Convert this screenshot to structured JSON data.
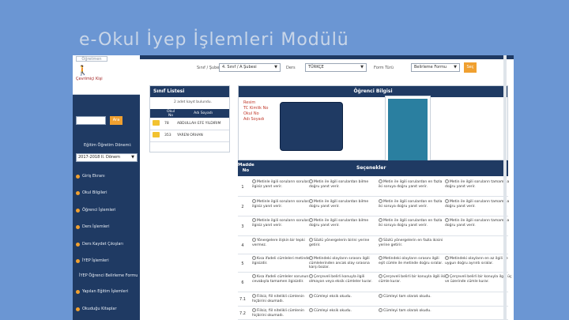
{
  "slide": {
    "title": "e-Okul İyep İşlemleri Modülü"
  },
  "user": {
    "role": "Öğretmen",
    "name": "Çevrimiçi Kişi"
  },
  "sidebar": {
    "search_btn": "Ara",
    "term_label": "Eğitim Öğretim Dönemi:",
    "term_value": "2017-2018 II. Dönem",
    "items": [
      {
        "label": "Giriş Ekranı"
      },
      {
        "label": "Okul Bilgileri"
      },
      {
        "label": "Öğrenci İşlemleri"
      },
      {
        "label": "Ders İşlemleri"
      },
      {
        "label": "Ders Kaydet Çıkışları"
      },
      {
        "label": "İYEP İşlemleri"
      },
      {
        "label": "İYEP Öğrenci Belirleme Formu"
      },
      {
        "label": "Yapılan Eğitim İşlemleri"
      },
      {
        "label": "Okuduğu Kitaplar"
      }
    ]
  },
  "filters": {
    "sinif_label": "Sınıf / Şubesi",
    "sinif_value": "4. Sınıf / A Şubesi",
    "ders_label": "Ders",
    "ders_value": "TÜRKÇE",
    "form_label": "Form Türü",
    "form_value": "Belirleme Formu",
    "go": "Seç"
  },
  "class_list": {
    "title": "Sınıf Listesi",
    "count": "2 adet kayıt bulundu.",
    "col_no": "Okul No",
    "col_name": "Adı Soyadı",
    "rows": [
      {
        "no": "78",
        "name": "ABDULLAH EFE YILDIRIM"
      },
      {
        "no": "353",
        "name": "YAREN ORHAN"
      }
    ]
  },
  "student_info": {
    "title": "Öğrenci Bilgisi",
    "labels": [
      "Resim",
      "TC Kimlik No",
      "Okul No",
      "Adı Soyadı"
    ]
  },
  "options": {
    "col_num": "Madde No",
    "col_title": "Seçenekler",
    "rows": [
      {
        "q": "1",
        "opts": [
          "Metinle ilgili soruların sorulara ilgisiz yanıt verir.",
          "Metin ile ilgili sorulardan bilme doğru yanıt verir.",
          "Metin ile ilgili sorulardan en fazla iki soruya doğru yanıt verir.",
          "Metin ile ilgili soruların tamamına doğru yanıt verir."
        ]
      },
      {
        "q": "2",
        "opts": [
          "Metinle ilgili soruların sorulara ilgisiz yanıt verir.",
          "Metin ile ilgili sorulardan bilme doğru yanıt verir.",
          "Metin ile ilgili sorulardan en fazla iki soruya doğru yanıt verir.",
          "Metin ile ilgili soruların tamamına doğru yanıt verir."
        ]
      },
      {
        "q": "3",
        "opts": [
          "Metinle ilgili soruların sorulara ilgisiz yanıt verir.",
          "Metin ile ilgili sorulardan bilme doğru yanıt verir.",
          "Metin ile ilgili sorulardan en fazla iki soruya doğru yanıt verir.",
          "Metin ile ilgili soruların tamamına doğru yanıt verir."
        ]
      },
      {
        "q": "4",
        "opts": [
          "Yönergelere ilişkin bir tepki vermez.",
          "Sözlü yönergelerin birini yerine getirir.",
          "Sözlü yönergelerin en fazla ikisini yerine getirir.",
          ""
        ]
      },
      {
        "q": "5",
        "opts": [
          "Kısa ifadeli cümleleri metinden ilgisizdir.",
          "Metindeki olayların sırasını ilgili cümlelerinden ancak olay sırasına karşı bozar.",
          "Metindeki olayların sırasını ilgili eşit cümle ile metinde doğru sıralar.",
          "Metindeki olayların en az ilgili ile uygun doğru ayrıntı sıralar."
        ]
      },
      {
        "q": "6",
        "opts": [
          "Kısa ifadeli cümleler sorunun cevabıyla tamamen ilgisizdir.",
          "Çerçeveli belirli konuyla ilgili olmayan veya eksik cümleler kurar.",
          "Çerçeveli belirli bir konuyla ilgili iki cümle kurar.",
          "Çerçeveli belirli bir konuyla ilgili üç ve üzerinde cümle kurar."
        ]
      },
      {
        "q": "7.1",
        "opts": [
          "Fiilsiz, fiil nitelikli cümlenin hiçbirini okumadı.",
          "Cümleyi eksik okudu.",
          "Cümleyi tam olarak okudu.",
          ""
        ]
      },
      {
        "q": "7.2",
        "opts": [
          "Fiilsiz, fiil nitelikli cümlenin hiçbirini okumadı.",
          "Cümleyi eksik okudu.",
          "Cümleyi tam olarak okudu.",
          ""
        ]
      }
    ]
  },
  "colors": {
    "navy": "#1f3a63",
    "accent": "#f0a030",
    "teal": "#2a7fa0",
    "slide_bg": "#6b96d3"
  }
}
